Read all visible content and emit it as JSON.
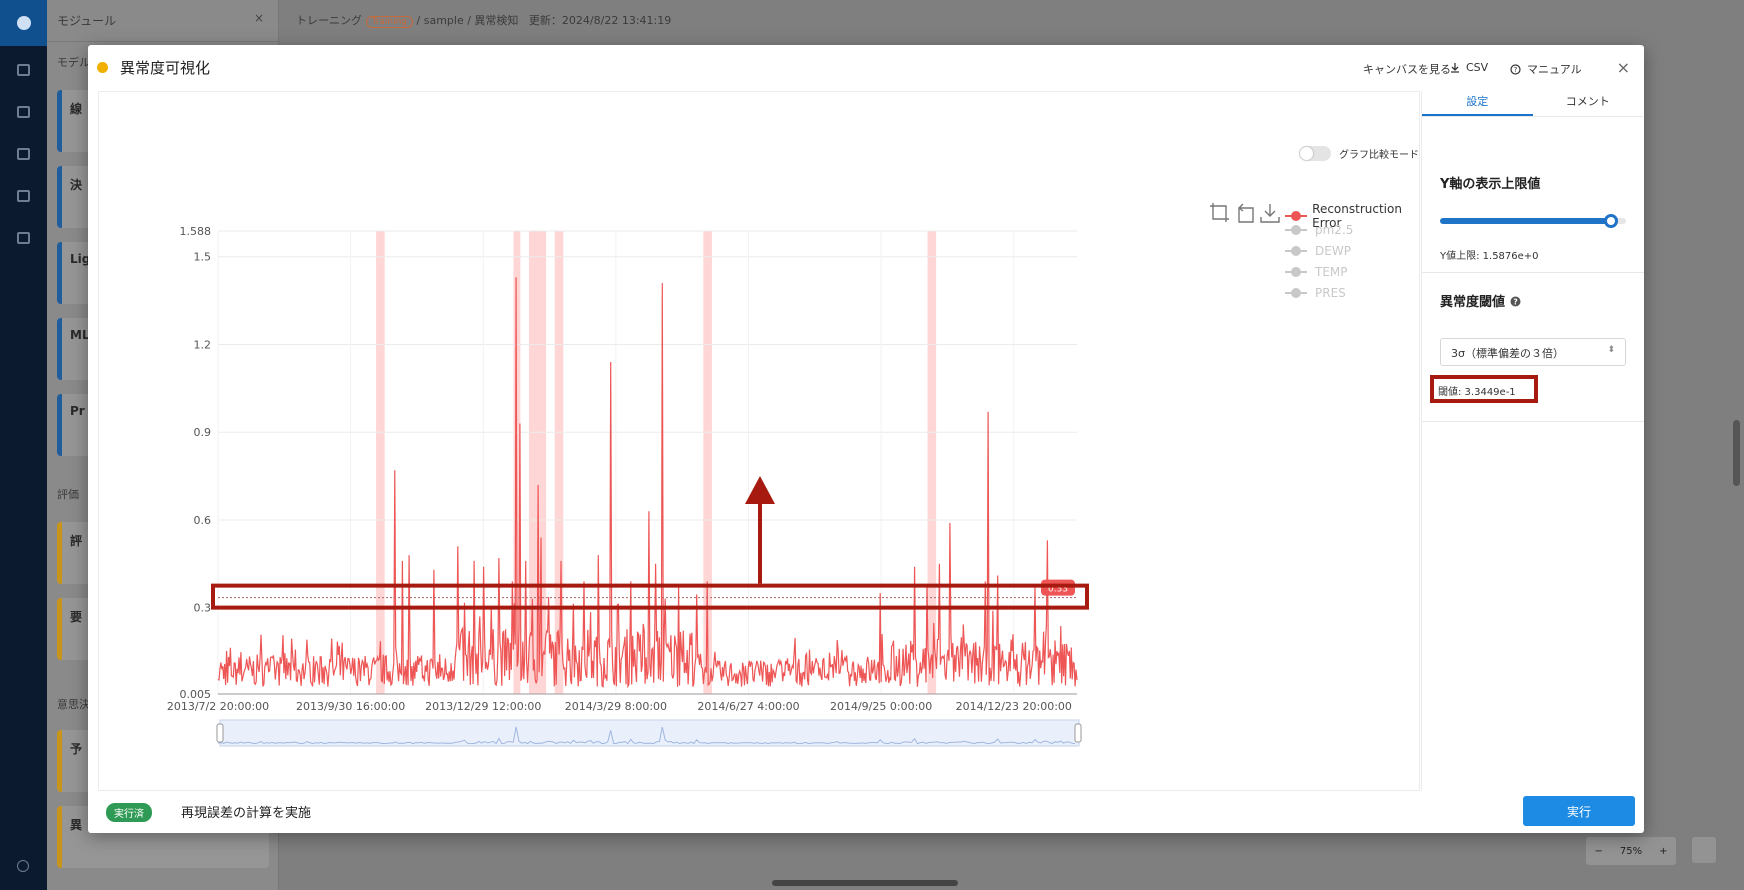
{
  "app": {
    "side_panel_title": "モジュール",
    "close_symbol": "×",
    "section_model": "モデル",
    "section_eval": "評価",
    "section_decision": "意思決",
    "model_cards": [
      "線",
      "決",
      "Lig",
      "ML",
      "Pr"
    ],
    "eval_cards": [
      "評",
      "要"
    ],
    "decision_cards": [
      "予",
      "異"
    ]
  },
  "breadcrumb": {
    "root": "トレーニング",
    "badge": "Training",
    "path": "/ sample / 異常検知",
    "updated": "更新：2024/8/22 13:41:19"
  },
  "zoom": {
    "minus": "−",
    "level": "75%",
    "plus": "+"
  },
  "modal": {
    "title": "異常度可視化",
    "actions": {
      "canvas": "キャンバスを見る",
      "csv": "CSV",
      "manual": "マニュアル"
    },
    "close": "×",
    "compare_toggle": "グラフ比較モード",
    "tabs": {
      "settings": "設定",
      "comment": "コメント"
    },
    "y_axis_section": "Y軸の表示上限値",
    "y_limit_text": "Y値上限: 1.5876e+0",
    "slider_fraction": 0.92,
    "anomaly_section": "異常度閾値",
    "threshold_select": "3σ（標準偏差の３倍）",
    "threshold_value": "閾値: 3.3449e-1",
    "status_badge": "実行済",
    "status_text": "再現誤差の計算を実施",
    "run_button": "実行"
  },
  "colors": {
    "series": "#ee5555",
    "highlight": "#ffd6d6",
    "annotation": "#a61a10",
    "accent": "#1d8ae3",
    "legend_inactive": "#c8c8c8"
  },
  "chart_data": {
    "type": "line",
    "y_ticks": [
      "1.588",
      "1.5",
      "1.2",
      "0.9",
      "0.6",
      "0.3",
      "0.005"
    ],
    "y_tick_values": [
      1.588,
      1.5,
      1.2,
      0.9,
      0.6,
      0.3,
      0.005
    ],
    "ylim": [
      0.005,
      1.588
    ],
    "x_ticks": [
      "2013/7/2 20:00:00",
      "2013/9/30 16:00:00",
      "2013/12/29 12:00:00",
      "2014/3/29 8:00:00",
      "2014/6/27 4:00:00",
      "2014/9/25 0:00:00",
      "2014/12/23 20:00:00"
    ],
    "x_tick_positions": [
      0,
      0.1544,
      0.3088,
      0.4632,
      0.6176,
      0.772,
      0.9264
    ],
    "threshold": 0.33449,
    "threshold_label": "0.33",
    "legend": [
      {
        "name": "Reconstruction Error",
        "active": true
      },
      {
        "name": "pm2.5",
        "active": false
      },
      {
        "name": "DEWP",
        "active": false
      },
      {
        "name": "TEMP",
        "active": false
      },
      {
        "name": "PRES",
        "active": false
      }
    ],
    "anomaly_bands": [
      [
        0.184,
        0.194
      ],
      [
        0.344,
        0.352
      ],
      [
        0.362,
        0.382
      ],
      [
        0.392,
        0.402
      ],
      [
        0.565,
        0.575
      ],
      [
        0.826,
        0.836
      ]
    ],
    "peaks": [
      [
        0.206,
        0.77
      ],
      [
        0.215,
        0.46
      ],
      [
        0.222,
        0.48
      ],
      [
        0.251,
        0.43
      ],
      [
        0.279,
        0.51
      ],
      [
        0.298,
        0.46
      ],
      [
        0.309,
        0.44
      ],
      [
        0.327,
        0.47
      ],
      [
        0.343,
        0.39
      ],
      [
        0.347,
        1.43
      ],
      [
        0.351,
        0.93
      ],
      [
        0.358,
        0.46
      ],
      [
        0.366,
        0.33
      ],
      [
        0.373,
        0.72
      ],
      [
        0.376,
        0.54
      ],
      [
        0.399,
        0.46
      ],
      [
        0.426,
        0.39
      ],
      [
        0.443,
        0.48
      ],
      [
        0.457,
        1.14
      ],
      [
        0.481,
        0.39
      ],
      [
        0.502,
        0.63
      ],
      [
        0.51,
        0.45
      ],
      [
        0.517,
        1.41
      ],
      [
        0.536,
        0.37
      ],
      [
        0.57,
        0.39
      ],
      [
        0.771,
        0.35
      ],
      [
        0.811,
        0.44
      ],
      [
        0.825,
        0.38
      ],
      [
        0.84,
        0.45
      ],
      [
        0.852,
        0.59
      ],
      [
        0.893,
        0.39
      ],
      [
        0.897,
        0.97
      ],
      [
        0.908,
        0.41
      ],
      [
        0.951,
        0.37
      ],
      [
        0.965,
        0.53
      ]
    ]
  }
}
